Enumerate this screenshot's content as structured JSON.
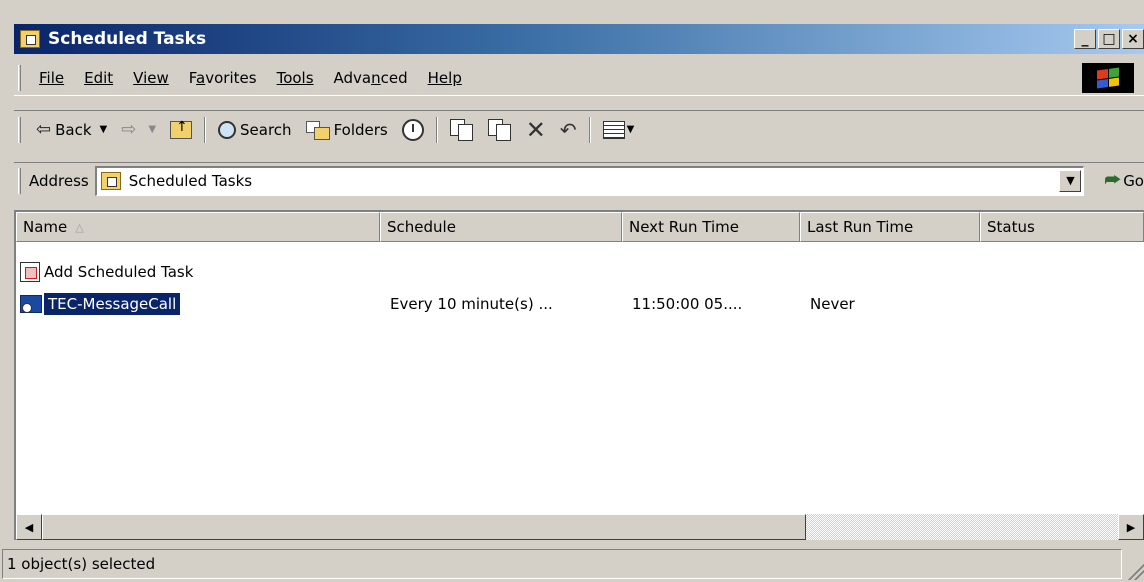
{
  "window": {
    "title": "Scheduled Tasks",
    "controls": [
      "_",
      "□",
      "×"
    ]
  },
  "menu": {
    "items": [
      {
        "label": "File",
        "mnemonic": "F"
      },
      {
        "label": "Edit",
        "mnemonic": "E"
      },
      {
        "label": "View",
        "mnemonic": "V"
      },
      {
        "label": "Favorites",
        "mnemonic": "a"
      },
      {
        "label": "Tools",
        "mnemonic": "T"
      },
      {
        "label": "Advanced",
        "mnemonic": "n"
      },
      {
        "label": "Help",
        "mnemonic": "H"
      }
    ]
  },
  "toolbar": {
    "back_label": "Back",
    "search_label": "Search",
    "folders_label": "Folders"
  },
  "address": {
    "label": "Address",
    "value": "Scheduled Tasks",
    "go_label": "Go"
  },
  "list": {
    "columns": [
      "Name",
      "Schedule",
      "Next Run Time",
      "Last Run Time",
      "Status"
    ],
    "sorted_column": "Name",
    "rows": [
      {
        "name": "Add Scheduled Task",
        "schedule": "",
        "next_run": "",
        "last_run": "",
        "status": "",
        "icon": "add-task-icon",
        "selected": false
      },
      {
        "name": "TEC-MessageCall",
        "schedule": "Every 10 minute(s) ...",
        "next_run": "11:50:00  05....",
        "last_run": "Never",
        "status": "",
        "icon": "scheduled-task-icon",
        "selected": true
      }
    ]
  },
  "status": {
    "text": "1 object(s) selected"
  },
  "colors": {
    "title_start": "#0a246a",
    "title_end": "#a6caf0",
    "selection": "#0a246a",
    "chrome": "#d4d0c8"
  }
}
